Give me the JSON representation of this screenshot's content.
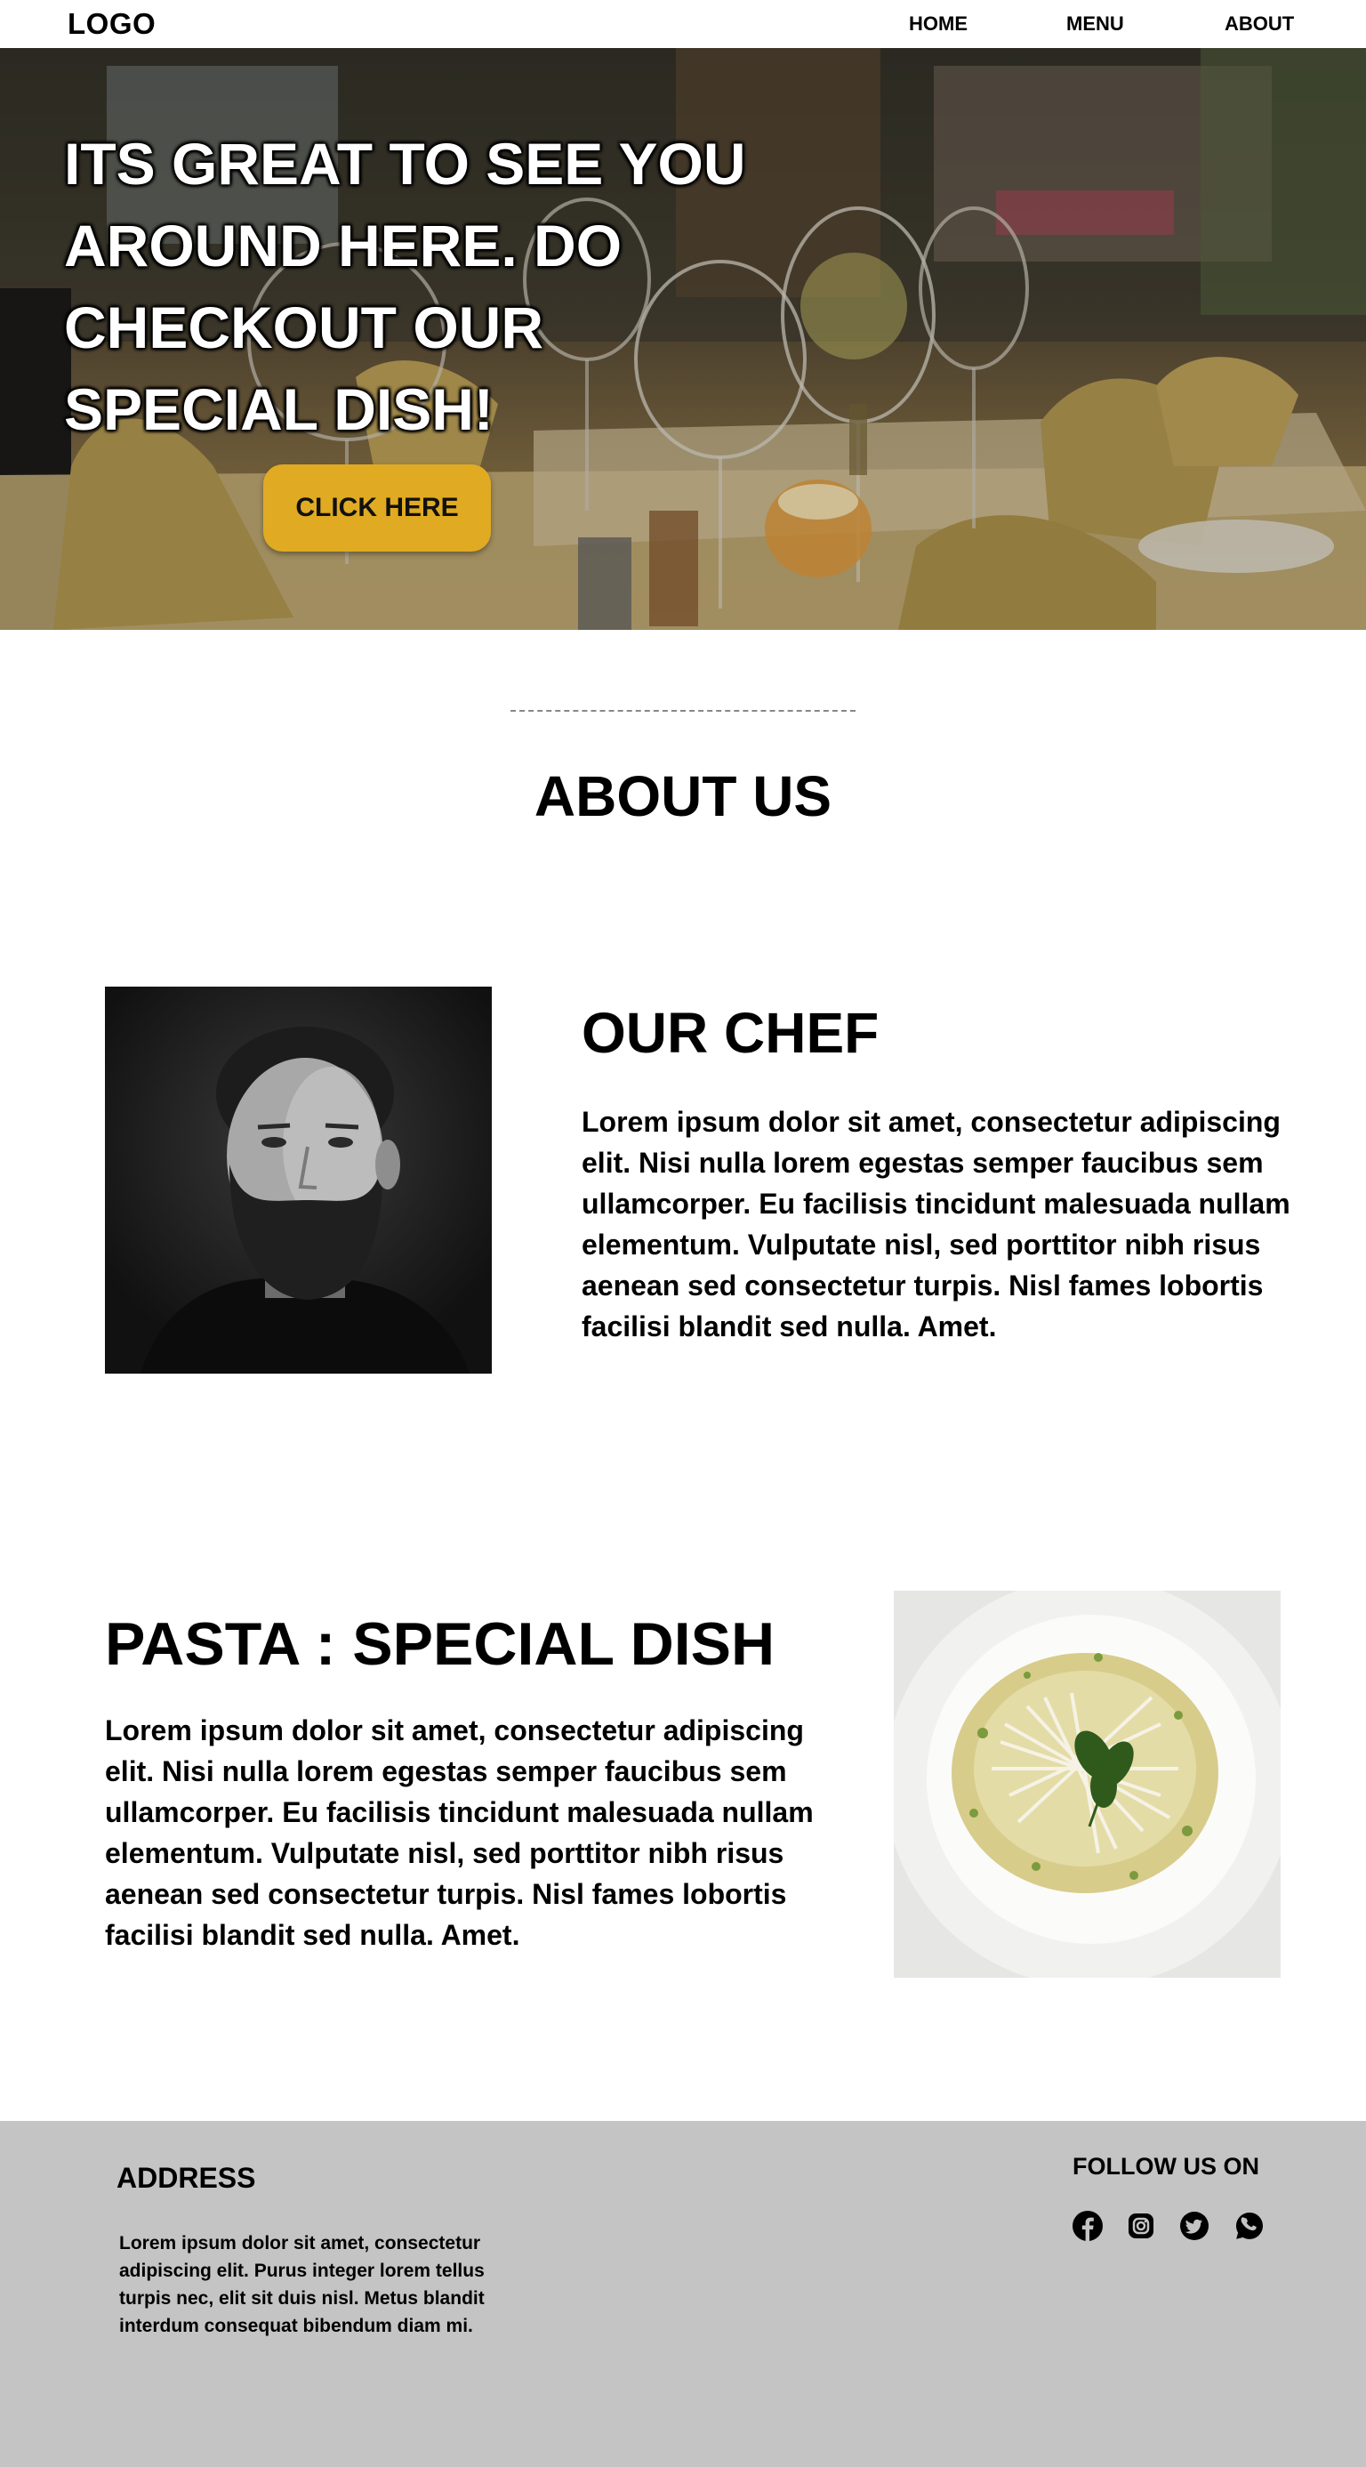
{
  "nav": {
    "logo": "LOGO",
    "links": [
      "HOME",
      "MENU",
      "ABOUT"
    ]
  },
  "hero": {
    "title": "ITS GREAT TO SEE YOU AROUND HERE. DO CHECKOUT OUR SPECIAL DISH!",
    "cta_label": "CLICK HERE",
    "cta_color": "#e0aa22"
  },
  "about": {
    "title": "ABOUT US"
  },
  "chef": {
    "heading": "OUR CHEF",
    "text": "Lorem ipsum dolor sit amet, consectetur adipiscing elit. Nisi nulla lorem egestas semper faucibus sem ullamcorper. Eu facilisis tincidunt malesuada nullam elementum. Vulputate nisl, sed porttitor nibh risus aenean sed consectetur turpis. Nisl fames lobortis facilisi blandit sed nulla. Amet."
  },
  "special": {
    "heading": "PASTA : SPECIAL DISH",
    "text": "Lorem ipsum dolor sit amet, consectetur adipiscing elit. Nisi nulla lorem egestas semper faucibus sem ullamcorper. Eu facilisis tincidunt malesuada nullam elementum. Vulputate nisl, sed porttitor nibh risus aenean sed consectetur turpis. Nisl fames lobortis facilisi blandit sed nulla. Amet."
  },
  "footer": {
    "address_heading": "ADDRESS",
    "address_text": "Lorem ipsum dolor sit amet, consectetur adipiscing elit. Purus integer lorem tellus turpis nec, elit sit duis nisl. Metus blandit interdum consequat bibendum diam mi.",
    "follow_heading": "FOLLOW US ON",
    "social_icons": [
      "facebook-icon",
      "instagram-icon",
      "twitter-icon",
      "whatsapp-icon"
    ],
    "background": "#c4c4c4"
  }
}
